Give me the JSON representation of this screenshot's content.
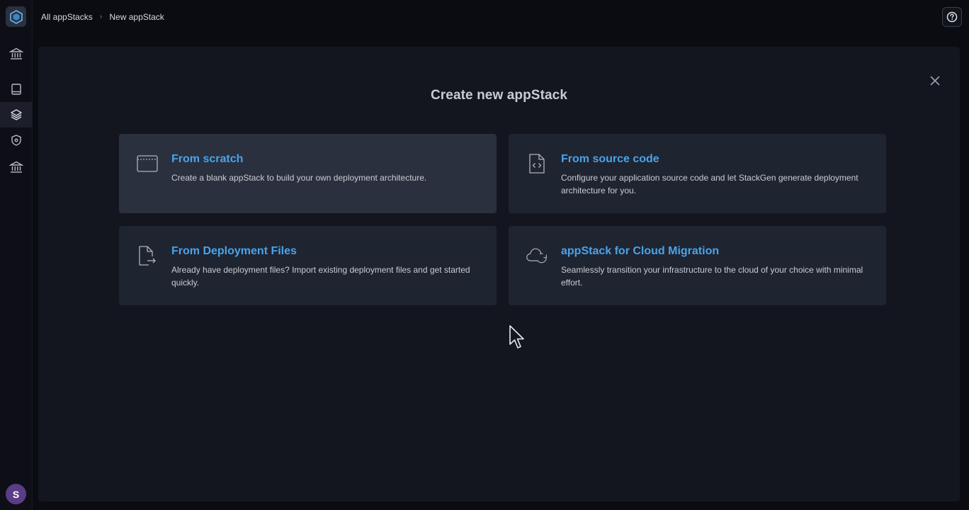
{
  "breadcrumb": {
    "items": [
      "All appStacks",
      "New appStack"
    ],
    "separator": "›"
  },
  "modal": {
    "title": "Create new appStack"
  },
  "options": [
    {
      "title": "From scratch",
      "description": "Create a blank appStack to build your own deployment architecture.",
      "icon": "window-icon"
    },
    {
      "title": "From source code",
      "description": "Configure your application source code and let StackGen generate deployment architecture for you.",
      "icon": "code-file-icon"
    },
    {
      "title": "From Deployment Files",
      "description": "Already have deployment files? Import existing deployment files and get started quickly.",
      "icon": "import-file-icon"
    },
    {
      "title": "appStack for Cloud Migration",
      "description": "Seamlessly transition your infrastructure to the cloud of your choice with minimal effort.",
      "icon": "cloud-sync-icon"
    }
  ],
  "user": {
    "avatar_initial": "S"
  },
  "colors": {
    "accent": "#4aa3e8",
    "background": "#0b0c12",
    "panel": "#14161f",
    "card": "#1f2431",
    "avatar": "#5b3c86"
  }
}
